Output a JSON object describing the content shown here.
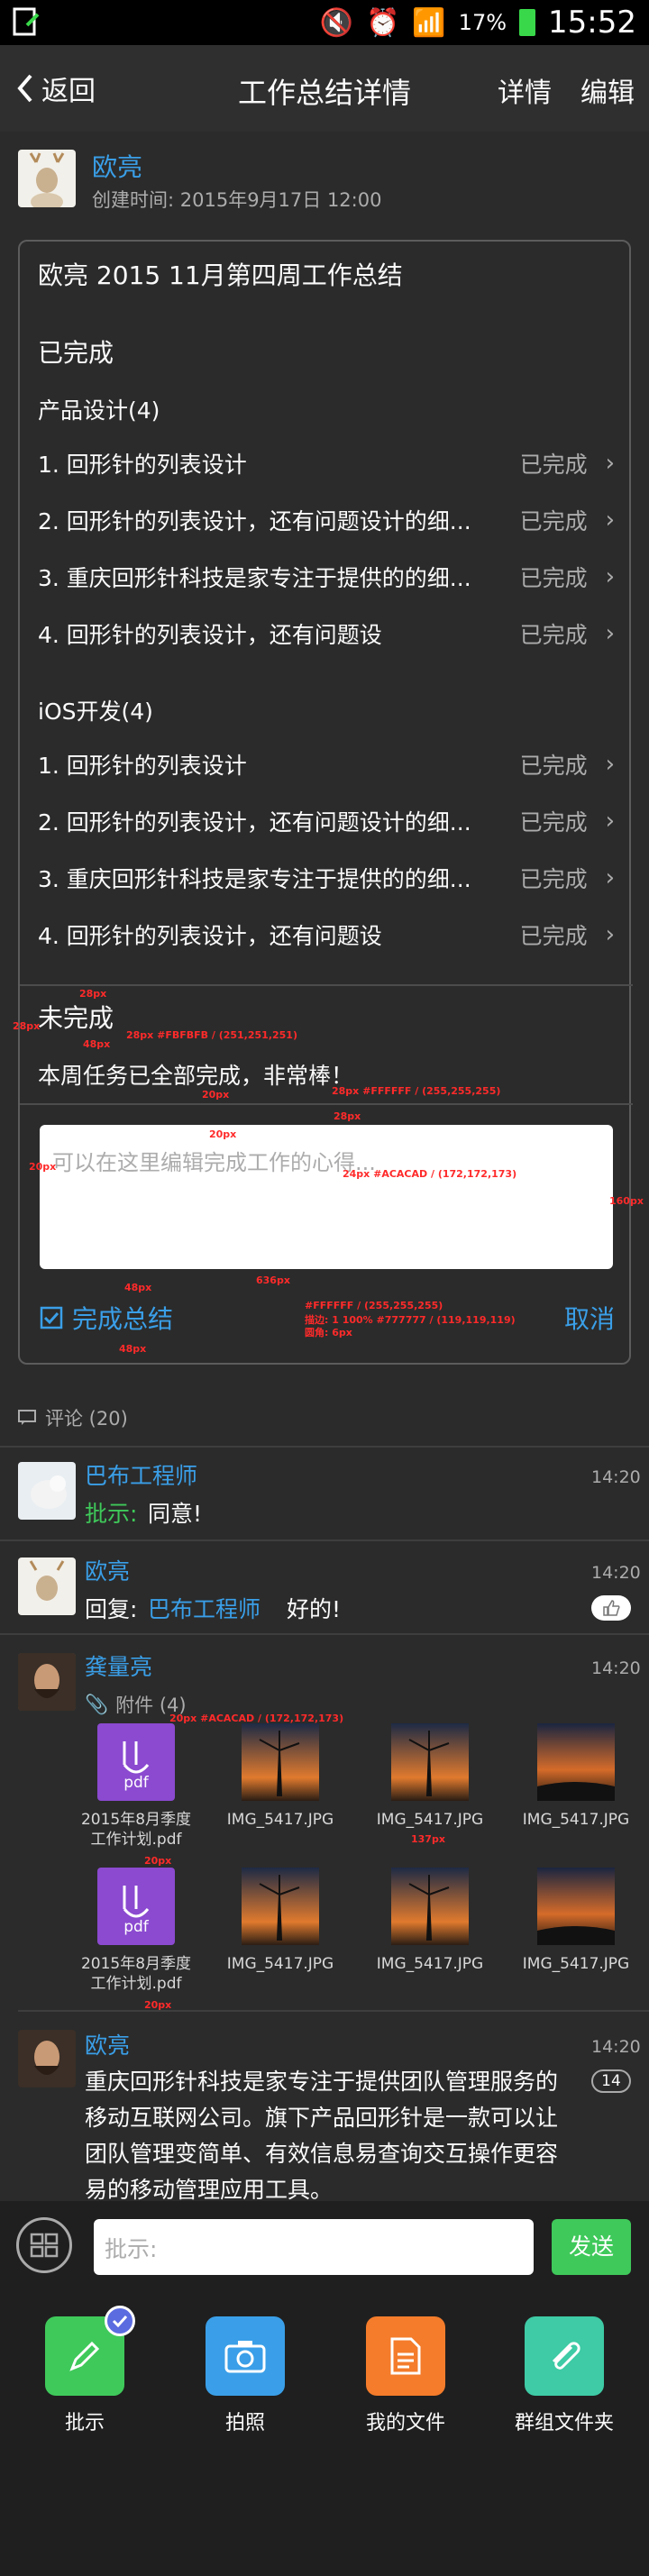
{
  "statusbar": {
    "battery": "17%",
    "time": "15:52"
  },
  "navbar": {
    "back": "返回",
    "title": "工作总结详情",
    "detail": "详情",
    "edit": "编辑"
  },
  "post": {
    "author": "欧亮",
    "created": "创建时间: 2015年9月17日  12:00"
  },
  "summary": {
    "title": "欧亮 2015 11月第四周工作总结",
    "done_heading": "已完成",
    "group1": {
      "name": "产品设计(4)",
      "items": [
        {
          "text": "1. 回形针的列表设计",
          "status": "已完成"
        },
        {
          "text": "2. 回形针的列表设计，还有问题设计的细...",
          "status": "已完成"
        },
        {
          "text": "3. 重庆回形针科技是家专注于提供的的细...",
          "status": "已完成"
        },
        {
          "text": "4. 回形针的列表设计，还有问题设",
          "status": "已完成"
        }
      ]
    },
    "group2": {
      "name": "iOS开发(4)",
      "items": [
        {
          "text": "1. 回形针的列表设计",
          "status": "已完成"
        },
        {
          "text": "2. 回形针的列表设计，还有问题设计的细...",
          "status": "已完成"
        },
        {
          "text": "3. 重庆回形针科技是家专注于提供的的细...",
          "status": "已完成"
        },
        {
          "text": "4. 回形针的列表设计，还有问题设",
          "status": "已完成"
        }
      ]
    },
    "undone_heading": "未完成",
    "undone_text": "本周任务已全部完成，非常棒！",
    "edit_placeholder": "可以在这里编辑完成工作的心得...",
    "complete_label": "完成总结",
    "cancel": "取消"
  },
  "annotations": {
    "a1": "28px",
    "a2": "28px",
    "a3": "48px",
    "a4": "28px #FBFBFB / (251,251,251)",
    "a5": "20px",
    "a6": "28px",
    "a7": "28px #FFFFFF / (255,255,255)",
    "a8": "20px",
    "a9": "24px #ACACAD / (172,172,173)",
    "a10": "160px",
    "a11": "48px",
    "a12": "636px",
    "a13": "#FFFFFF / (255,255,255)",
    "a14": "描边: 1 100% #777777 / (119,119,119)",
    "a15": "圆角: 6px",
    "a16": "48px",
    "a17": "20px #ACACAD / (172,172,173)",
    "a18": "20px",
    "a19": "137px",
    "a20": "20px"
  },
  "comments": {
    "header": "评论 (20)",
    "list": [
      {
        "name": "巴布工程师",
        "time": "14:20",
        "label": "批示:",
        "text": "同意!"
      },
      {
        "name": "欧亮",
        "time": "14:20",
        "label": "回复:",
        "mention": "巴布工程师",
        "text": "好的!"
      },
      {
        "name": "龚量亮",
        "time": "14:20",
        "attach": "附件 (4)",
        "files": [
          "2015年8月季度工作计划.pdf",
          "IMG_5417.JPG",
          "IMG_5417.JPG",
          "IMG_5417.JPG",
          "2015年8月季度工作计划.pdf",
          "IMG_5417.JPG",
          "IMG_5417.JPG",
          "IMG_5417.JPG"
        ],
        "pdf": "pdf"
      },
      {
        "name": "欧亮",
        "time": "14:20",
        "count": "14",
        "text": "重庆回形针科技是家专注于提供团队管理服务的移动互联网公司。旗下产品回形针是一款可以让团队管理变简单、有效信息易查询交互操作更容易的移动管理应用工具。"
      }
    ]
  },
  "input": {
    "placeholder": "批示:",
    "send": "发送"
  },
  "tools": [
    {
      "label": "批示"
    },
    {
      "label": "拍照"
    },
    {
      "label": "我的文件"
    },
    {
      "label": "群组文件夹"
    }
  ],
  "colors": {
    "accent": "#3a9fe8",
    "green": "#3fc95a",
    "orange": "#f47c2b",
    "teal": "#3ecba5"
  }
}
